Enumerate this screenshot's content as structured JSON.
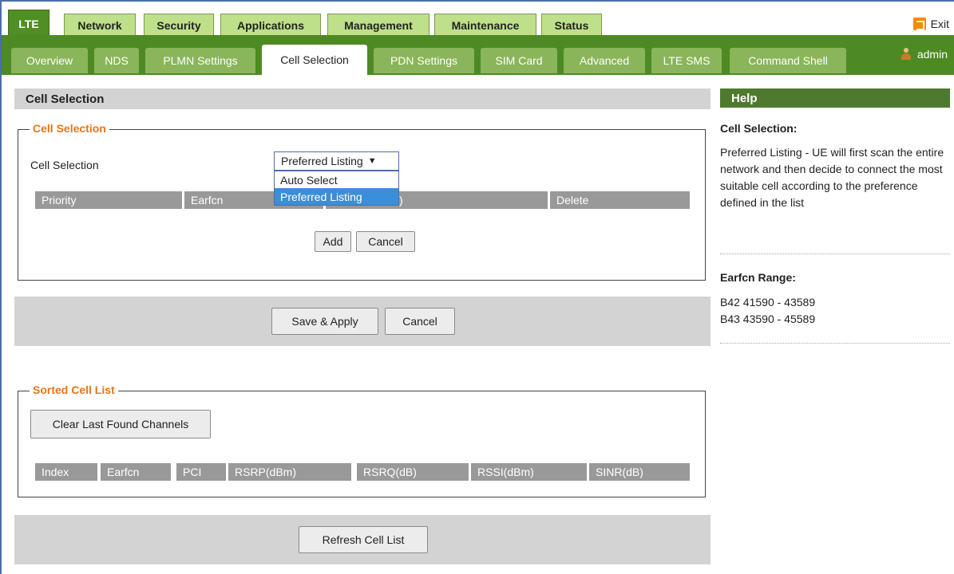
{
  "top_tabs": [
    "LTE",
    "Network",
    "Security",
    "Applications",
    "Management",
    "Maintenance",
    "Status"
  ],
  "exit_label": "Exit",
  "sub_tabs": [
    "Overview",
    "NDS",
    "PLMN Settings",
    "Cell Selection",
    "PDN Settings",
    "SIM Card",
    "Advanced",
    "LTE SMS",
    "Command Shell"
  ],
  "admin_label": "admin",
  "page_header": "Cell Selection",
  "cell_selection": {
    "legend": "Cell Selection",
    "field_label": "Cell Selection",
    "selected_value": "Preferred Listing",
    "options": [
      "Auto Select",
      "Preferred Listing"
    ],
    "columns": [
      "Priority",
      "Earfcn",
      ")",
      "Delete"
    ],
    "add_label": "Add",
    "cancel_label": "Cancel"
  },
  "save_apply_label": "Save & Apply",
  "save_cancel_label": "Cancel",
  "sorted_list": {
    "legend": "Sorted Cell List",
    "clear_label": "Clear Last Found Channels",
    "columns": [
      "Index",
      "Earfcn",
      "PCI",
      "RSRP(dBm)",
      "RSRQ(dB)",
      "RSSI(dBm)",
      "SINR(dB)"
    ]
  },
  "refresh_label": "Refresh Cell List",
  "help": {
    "header": "Help",
    "cell_title": "Cell Selection:",
    "cell_text": "Preferred Listing - UE will first scan the entire network and then decide to connect the most suitable cell according to the preference defined in the list",
    "earfcn_title": "Earfcn Range:",
    "earfcn_lines": [
      "B42 41590 - 43589",
      "B43 43590 - 45589"
    ]
  }
}
